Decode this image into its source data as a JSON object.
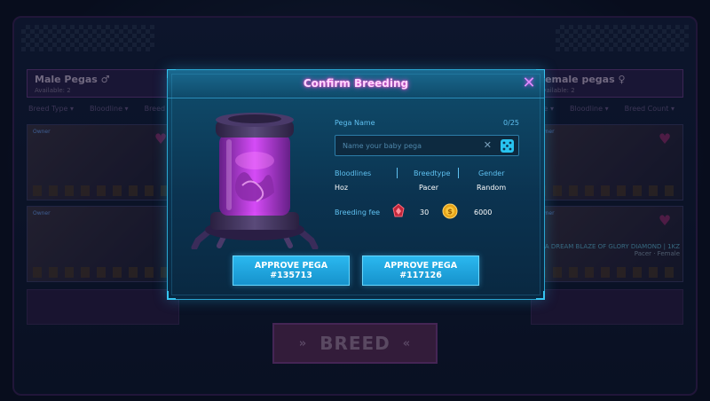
{
  "background": {
    "male_panel": {
      "title": "Male Pegas ♂",
      "subtitle": "Available: 2"
    },
    "female_panel": {
      "title": "Female pegas ♀",
      "subtitle": "Available: 2"
    },
    "filters_left": [
      "Breed Type ▾",
      "Bloodline ▾",
      "Breed Count ▾"
    ],
    "filters_right": [
      "Breed Type ▾",
      "Bloodline ▾",
      "Breed Count ▾"
    ],
    "card_tag": "Owner",
    "female_card_text": "PEGA DREAM BLAZE OF GLORY DIAMOND | 1KZ",
    "female_card_sub": "Pacer · Female",
    "breed_button": "BREED",
    "breed_chevron_left": "»",
    "breed_chevron_right": "«"
  },
  "modal": {
    "title": "Confirm Breeding",
    "close_icon": "✕",
    "name_field": {
      "label": "Pega Name",
      "count": "0/25",
      "placeholder": "Name your baby pega",
      "value": ""
    },
    "clear_icon": "✕",
    "columns": [
      {
        "header": "Bloodlines",
        "value": "Hoz"
      },
      {
        "header": "Breedtype",
        "value": "Pacer"
      },
      {
        "header": "Gender",
        "value": "Random"
      }
    ],
    "fee": {
      "label": "Breeding fee",
      "token1_amount": "30",
      "token2_amount": "6000"
    },
    "buttons": {
      "approve_1": "APPROVE PEGA #135713",
      "approve_2": "APPROVE PEGA #117126"
    }
  },
  "colors": {
    "accent": "#2bb8ef",
    "title_glow": "#ff4fd8",
    "label": "#5fc0f0"
  }
}
